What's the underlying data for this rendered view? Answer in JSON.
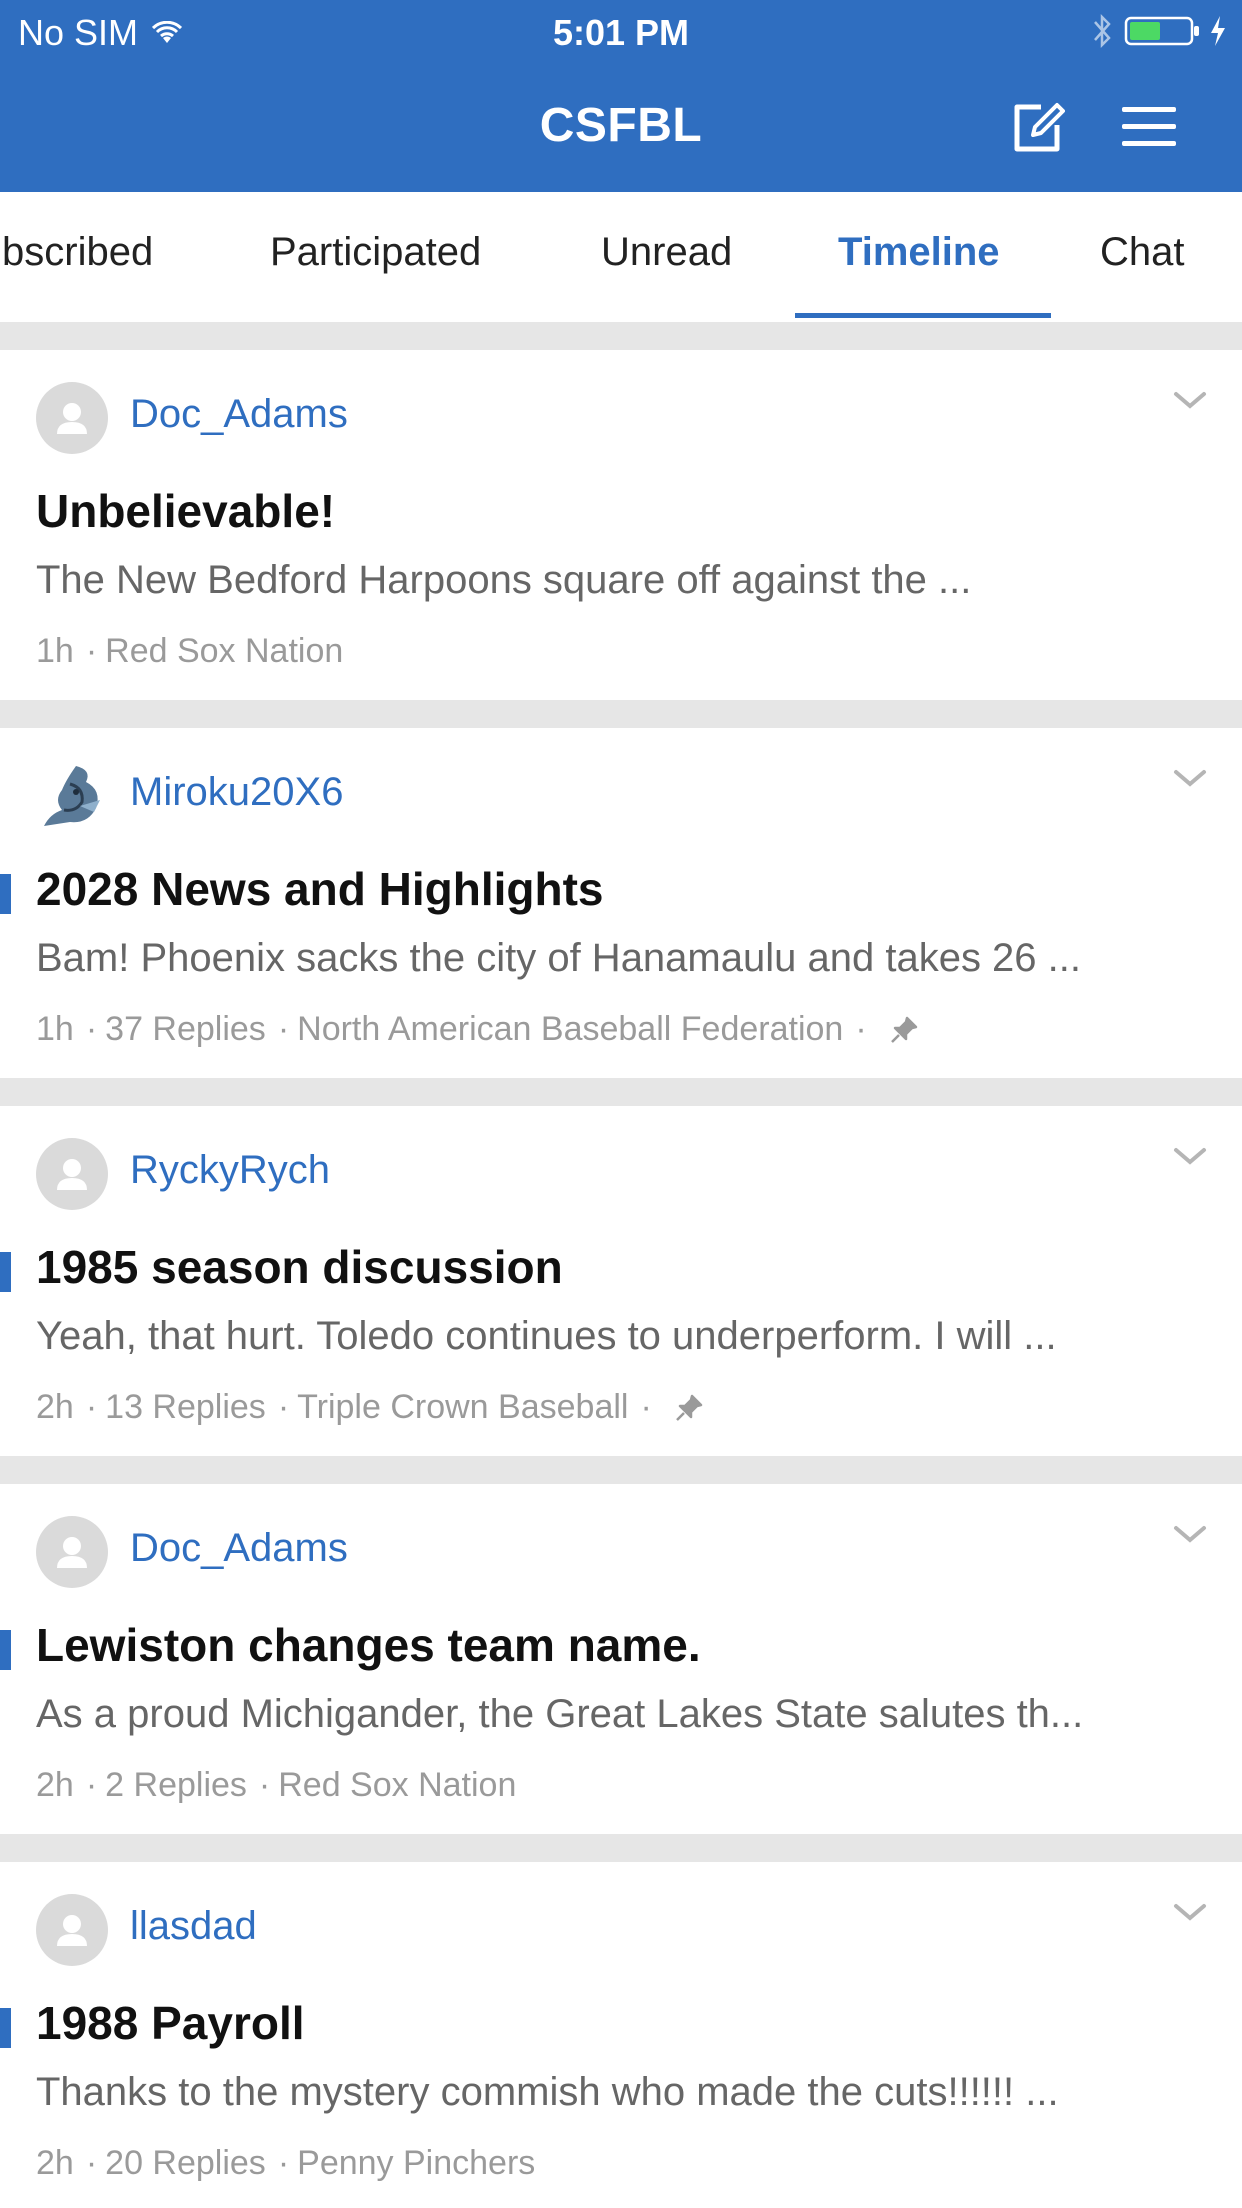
{
  "status_bar": {
    "carrier": "No SIM",
    "time": "5:01 PM"
  },
  "nav": {
    "title": "CSFBL",
    "compose_icon": "compose-icon",
    "menu_icon": "hamburger-menu-icon"
  },
  "tabs": [
    {
      "label": "bscribed",
      "active": false
    },
    {
      "label": "Participated",
      "active": false
    },
    {
      "label": "Unread",
      "active": false
    },
    {
      "label": "Timeline",
      "active": true
    },
    {
      "label": "Chat",
      "active": false
    }
  ],
  "posts": [
    {
      "username": "Doc_Adams",
      "avatar": "default-avatar",
      "title": "Unbelievable!",
      "preview": "The New Bedford Harpoons square off against the ...",
      "time": "1h",
      "replies": "",
      "forum": "Red Sox Nation",
      "unread": false,
      "pinned": false
    },
    {
      "username": "Miroku20X6",
      "avatar": "custom-avatar",
      "title": "2028 News and Highlights",
      "preview": "Bam! Phoenix sacks the city of Hanamaulu and takes 26 ...",
      "time": "1h",
      "replies": "37 Replies",
      "forum": "North American Baseball Federation",
      "unread": true,
      "pinned": true
    },
    {
      "username": "RyckyRych",
      "avatar": "default-avatar",
      "title": "1985 season discussion",
      "preview": "Yeah, that hurt. Toledo continues to underperform. I will ...",
      "time": "2h",
      "replies": "13 Replies",
      "forum": "Triple Crown Baseball",
      "unread": true,
      "pinned": true
    },
    {
      "username": "Doc_Adams",
      "avatar": "default-avatar",
      "title": "Lewiston changes team name.",
      "preview": "As a proud Michigander, the Great Lakes State salutes th...",
      "time": "2h",
      "replies": "2 Replies",
      "forum": "Red Sox Nation",
      "unread": true,
      "pinned": false
    },
    {
      "username": "llasdad",
      "avatar": "default-avatar",
      "title": "1988 Payroll",
      "preview": "Thanks to the mystery commish who made the cuts!!!!!! ...",
      "time": "2h",
      "replies": "20 Replies",
      "forum": "Penny Pinchers",
      "unread": true,
      "pinned": false
    }
  ],
  "colors": {
    "accent": "#2f6ec0",
    "username": "#2f6ec0",
    "meta": "#9a9a9a",
    "separator": "#e6e6e6"
  }
}
